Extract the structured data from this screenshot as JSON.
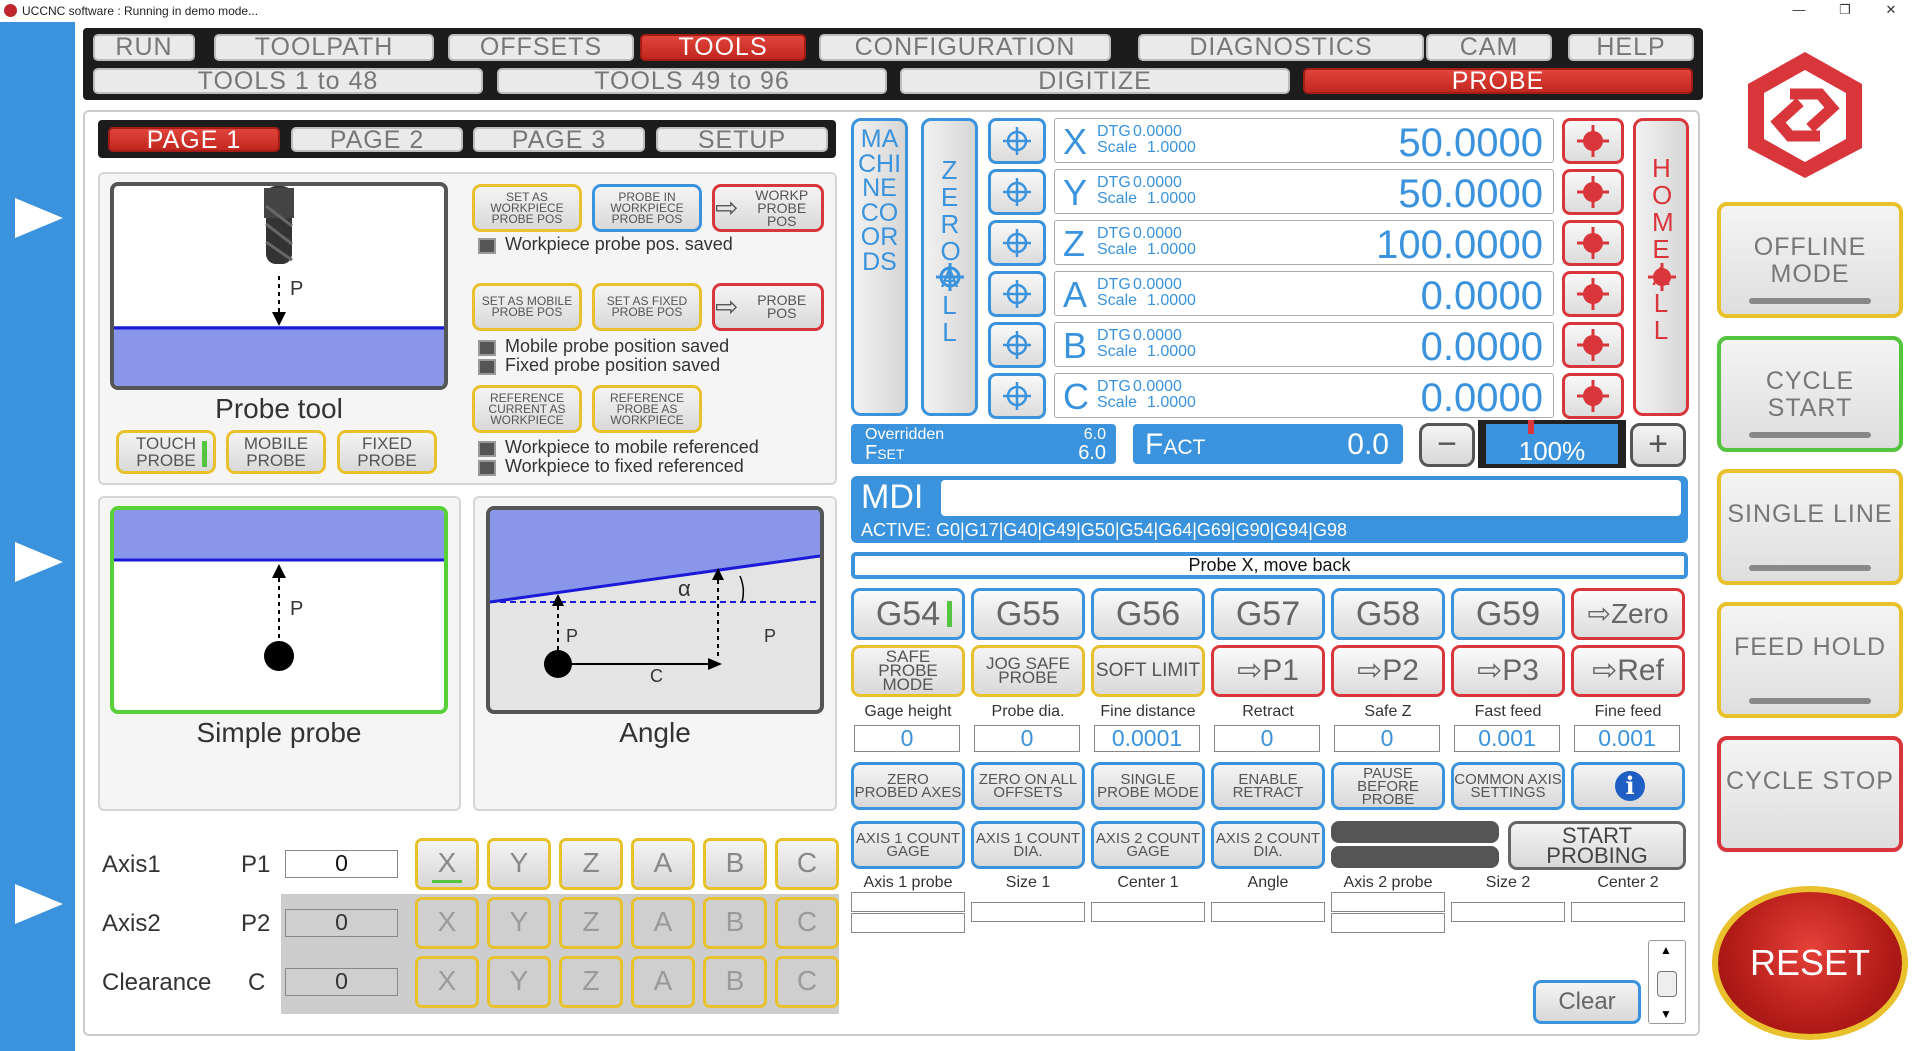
{
  "window": {
    "title": "UCCNC software : Running in demo mode...",
    "minimize": "—",
    "restore": "❐",
    "close": "✕"
  },
  "main_tabs": [
    "RUN",
    "TOOLPATH",
    "OFFSETS",
    "TOOLS",
    "CONFIGURATION",
    "DIAGNOSTICS",
    "CAM",
    "HELP"
  ],
  "sub_tabs": [
    "TOOLS  1 to 48",
    "TOOLS  49 to 96",
    "DIGITIZE",
    "PROBE"
  ],
  "page_tabs": [
    "PAGE 1",
    "PAGE 2",
    "PAGE 3",
    "SETUP"
  ],
  "probe_tool": {
    "buttons": {
      "set_workpiece": "SET AS WORKPIECE PROBE POS",
      "probe_in_workpiece": "PROBE IN WORKPIECE PROBE POS",
      "workp_probe_pos": "WORKP PROBE POS",
      "set_mobile": "SET AS MOBILE PROBE POS",
      "set_fixed": "SET AS FIXED PROBE POS",
      "probe_pos": "PROBE POS",
      "ref_current": "REFERENCE CURRENT AS WORKPIECE",
      "ref_probe": "REFERENCE PROBE AS WORKPIECE",
      "touch_probe": "TOUCH PROBE",
      "mobile_probe": "MOBILE PROBE",
      "fixed_probe": "FIXED PROBE"
    },
    "status": {
      "workpiece_saved": "Workpiece probe pos. saved",
      "mobile_saved": "Mobile probe position saved",
      "fixed_saved": "Fixed probe position saved",
      "mobile_ref": "Workpiece to mobile referenced",
      "fixed_ref": "Workpiece to fixed referenced"
    },
    "image_label": "P",
    "caption": "Probe tool"
  },
  "simple_probe": {
    "caption": "Simple probe",
    "label": "P"
  },
  "angle": {
    "caption": "Angle",
    "alpha": "α",
    "p1": "P",
    "p2": "P",
    "c": "C"
  },
  "axis_rows": [
    {
      "name": "Axis1",
      "param": "P1",
      "value": "0"
    },
    {
      "name": "Axis2",
      "param": "P2",
      "value": "0"
    },
    {
      "name": "Clearance",
      "param": "C",
      "value": "0"
    }
  ],
  "axis_letters": [
    "X",
    "Y",
    "Z",
    "A",
    "B",
    "C"
  ],
  "coords": {
    "machine_coords": "MACHINE COORDS",
    "zero_all": "ZERO ALL",
    "home_all": "HOME ALL",
    "dtg_label": "DTG",
    "scale_label": "Scale",
    "axes": [
      {
        "letter": "X",
        "dtg": "0.0000",
        "scale": "1.0000",
        "value": "50.0000"
      },
      {
        "letter": "Y",
        "dtg": "0.0000",
        "scale": "1.0000",
        "value": "50.0000"
      },
      {
        "letter": "Z",
        "dtg": "0.0000",
        "scale": "1.0000",
        "value": "100.0000"
      },
      {
        "letter": "A",
        "dtg": "0.0000",
        "scale": "1.0000",
        "value": "0.0000"
      },
      {
        "letter": "B",
        "dtg": "0.0000",
        "scale": "1.0000",
        "value": "0.0000"
      },
      {
        "letter": "C",
        "dtg": "0.0000",
        "scale": "1.0000",
        "value": "0.0000"
      }
    ]
  },
  "feed": {
    "overridden_label": "Overridden",
    "overridden": "6.0",
    "fset_label": "Fset",
    "fset": "6.0",
    "fact_label": "Fact",
    "fact": "0.0",
    "override_pct": "100%",
    "override_level": 1.0,
    "minus": "−",
    "plus": "+"
  },
  "mdi": {
    "label": "MDI",
    "value": "",
    "active": "ACTIVE: G0|G17|G40|G49|G50|G54|G64|G69|G90|G94|G98"
  },
  "status_line": "Probe X, move back",
  "gcodes": [
    "G54",
    "G55",
    "G56",
    "G57",
    "G58",
    "G59"
  ],
  "zero_btn": "Zero",
  "row2": {
    "safe_probe": "SAFE PROBE MODE",
    "jog_safe": "JOG SAFE PROBE",
    "soft_limit": "SOFT LIMIT",
    "p1": "P1",
    "p2": "P2",
    "p3": "P3",
    "ref": "Ref"
  },
  "params": [
    {
      "label": "Gage height",
      "value": "0"
    },
    {
      "label": "Probe dia.",
      "value": "0"
    },
    {
      "label": "Fine distance",
      "value": "0.0001"
    },
    {
      "label": "Retract",
      "value": "0"
    },
    {
      "label": "Safe Z",
      "value": "0"
    },
    {
      "label": "Fast feed",
      "value": "0.001"
    },
    {
      "label": "Fine feed",
      "value": "0.001"
    }
  ],
  "row3": {
    "zero_probed": "ZERO PROBED AXES",
    "zero_offsets": "ZERO ON ALL OFFSETS",
    "single_probe": "SINGLE PROBE MODE",
    "enable_retract": "ENABLE RETRACT",
    "pause_before": "PAUSE BEFORE PROBE",
    "common_axis": "COMMON AXIS SETTINGS",
    "info": "i"
  },
  "row4": {
    "axis1_gage": "AXIS 1 COUNT GAGE",
    "axis1_dia": "AXIS 1 COUNT DIA.",
    "axis2_gage": "AXIS 2 COUNT GAGE",
    "axis2_dia": "AXIS 2 COUNT DIA.",
    "start_probing": "START PROBING"
  },
  "results": [
    "Axis 1 probe",
    "Size 1",
    "Center 1",
    "Angle",
    "Axis 2 probe",
    "Size 2",
    "Center 2"
  ],
  "clear": "Clear",
  "side": {
    "offline": "OFFLINE MODE",
    "cycle_start": "CYCLE START",
    "single_line": "SINGLE LINE",
    "feed_hold": "FEED HOLD",
    "cycle_stop": "CYCLE STOP",
    "reset": "RESET"
  },
  "colors": {
    "accent_red": "#d9363c",
    "accent_blue": "#3a93dc",
    "accent_yellow": "#e8c12d",
    "accent_green": "#55c43f"
  }
}
